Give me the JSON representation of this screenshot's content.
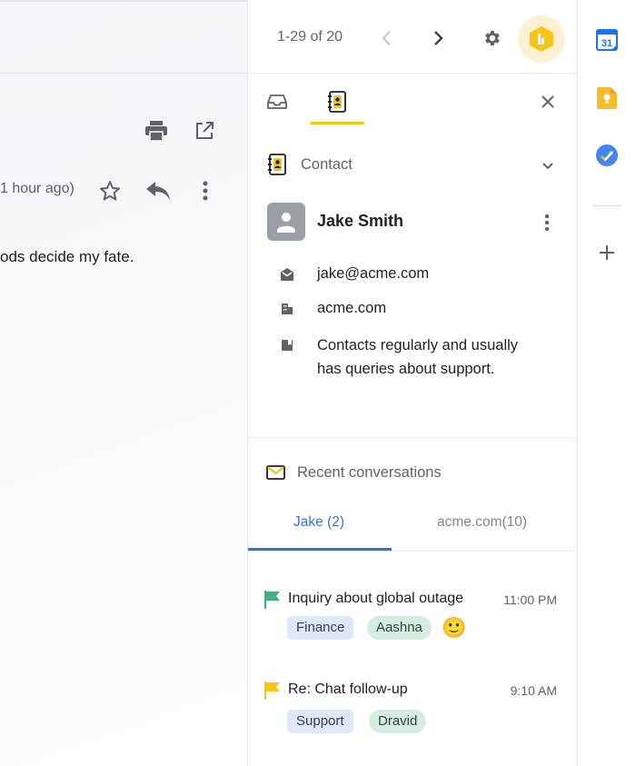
{
  "mail": {
    "time_ago": "1 hour ago)",
    "body_text": "ods decide my fate."
  },
  "toolbar": {
    "pager": "1-29 of 20"
  },
  "panel": {
    "contact_section_title": "Contact",
    "contact": {
      "name": "Jake Smith",
      "email": "jake@acme.com",
      "company": "acme.com",
      "note_line1": "Contacts regularly and usually",
      "note_line2": "has queries about support."
    },
    "recent_title": "Recent conversations",
    "conv_tabs": [
      {
        "label": "Jake (2)",
        "active": true
      },
      {
        "label": "acme.com(10)",
        "active": false
      }
    ],
    "conversations": [
      {
        "subject": "Inquiry about global outage",
        "time": "11:00 PM",
        "flag_color": "#3fb37f",
        "tags": [
          {
            "label": "Finance",
            "style": "blue"
          },
          {
            "label": "Aashna",
            "style": "green"
          }
        ],
        "emoji": "🙂"
      },
      {
        "subject": "Re: Chat follow-up",
        "time": "9:10 AM",
        "flag_color": "#f5c518",
        "tags": [
          {
            "label": "Support",
            "style": "blue"
          },
          {
            "label": "Dravid",
            "style": "green"
          }
        ]
      }
    ]
  },
  "rail": {
    "calendar_day": "31"
  },
  "colors": {
    "accent_blue": "#3b6fd1",
    "accent_yellow": "#f5c518"
  }
}
